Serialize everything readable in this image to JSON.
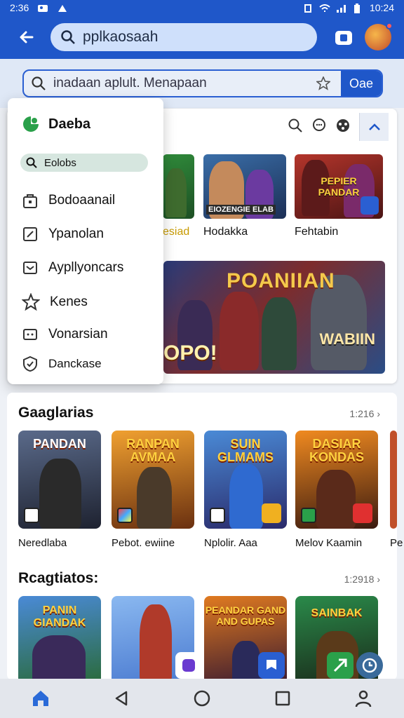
{
  "status_bar": {
    "time_left": "2:36",
    "time_right": "10:24"
  },
  "appbar": {
    "search_text": "pplkaosaah"
  },
  "sub_search": {
    "text": "inadaan aplult. Menapaan",
    "button": "Oae"
  },
  "menu": {
    "title": "Daeba",
    "search_label": "Eolobs",
    "items": [
      {
        "label": "Bodoaanail",
        "icon": "bag-icon"
      },
      {
        "label": "Ypanolan",
        "icon": "edit-icon"
      },
      {
        "label": "Aypllyoncars",
        "icon": "inbox-icon"
      },
      {
        "label": "Kenes",
        "icon": "star-icon"
      },
      {
        "label": "Vonarsian",
        "icon": "gamepad-icon"
      },
      {
        "label": "Danckase",
        "icon": "shield-icon"
      }
    ]
  },
  "top_row": {
    "tiles": [
      {
        "label": "esiad",
        "caption": ""
      },
      {
        "label": "Hodakka",
        "caption": "EIOZENGIE ELAB"
      },
      {
        "label": "Fehtabin",
        "caption": "PEPIER PANDAR"
      }
    ]
  },
  "banner": {
    "title": "POANIIAN",
    "left_text": "OPO!",
    "right_text": "WABIIN"
  },
  "sections": [
    {
      "title": "Gaaglarias",
      "count": "1:216 1",
      "cards": [
        {
          "art_title": "PANDAN",
          "label": "Neredlaba"
        },
        {
          "art_title": "RANPAN AVMAA",
          "label": "Pebot. ewiine"
        },
        {
          "art_title": "SUIN GLMAMS",
          "label": "Nplolir. Aaa"
        },
        {
          "art_title": "DASIAR KONDAS",
          "label": "Melov Kaamin"
        },
        {
          "art_title": "",
          "label": "Pe"
        }
      ]
    },
    {
      "title": "Rcagtiatos:",
      "count": "1:2918 1",
      "cards": [
        {
          "art_title": "PANIN GIANDAK"
        },
        {
          "art_title": ""
        },
        {
          "art_title": "PEANDAR GAND AND GUPAS"
        },
        {
          "art_title": "SAINBAK"
        }
      ]
    }
  ],
  "colors": {
    "primary": "#1f57c9",
    "panel": "#ffffff",
    "nav_bg": "#e3e6ec"
  }
}
